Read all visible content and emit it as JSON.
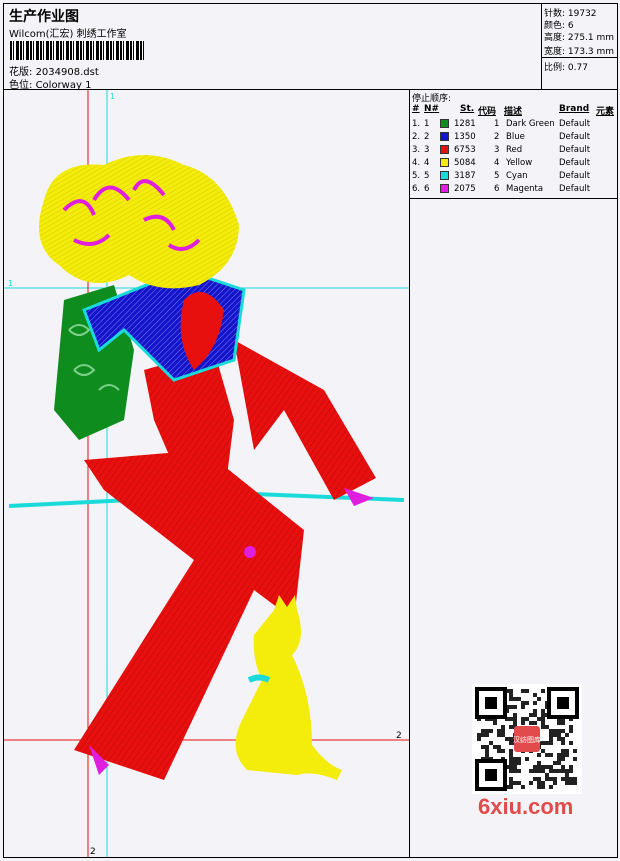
{
  "header": {
    "title": "生产作业图",
    "studio": "Wilcom(汇宏) 刺绣工作室",
    "file_label": "花版:",
    "file_name": "2034908.dst",
    "colorway_label": "色位:",
    "colorway": "Colorway 1"
  },
  "stats": {
    "stitches": "针数: 19732",
    "colors": "颜色: 6",
    "height": "高度: 275.1 mm",
    "width": "宽度: 173.3 mm",
    "scale": "比例: 0.77"
  },
  "stop_table": {
    "title": "停止顺序:",
    "headers": [
      "#",
      "N#",
      "St.",
      "代码",
      "描述",
      "Brand",
      "元素"
    ],
    "rows": [
      {
        "idx": "1.",
        "n": "1",
        "st": "1281",
        "code": "1",
        "desc": "Dark Green",
        "brand": "Default",
        "color": "#0f8c1e"
      },
      {
        "idx": "2.",
        "n": "2",
        "st": "1350",
        "code": "2",
        "desc": "Blue",
        "brand": "Default",
        "color": "#1414c8"
      },
      {
        "idx": "3.",
        "n": "3",
        "st": "6753",
        "code": "3",
        "desc": "Red",
        "brand": "Default",
        "color": "#e80f0f"
      },
      {
        "idx": "4.",
        "n": "4",
        "st": "5084",
        "code": "4",
        "desc": "Yellow",
        "brand": "Default",
        "color": "#f4ec0a"
      },
      {
        "idx": "5.",
        "n": "5",
        "st": "3187",
        "code": "5",
        "desc": "Cyan",
        "brand": "Default",
        "color": "#1adada"
      },
      {
        "idx": "6.",
        "n": "6",
        "st": "2075",
        "code": "6",
        "desc": "Magenta",
        "brand": "Default",
        "color": "#e01ee0"
      }
    ]
  },
  "guides": {
    "v_label": "1",
    "h_label": "1",
    "v2_label": "2",
    "h2_label": "2"
  },
  "watermark": "6xiu.com",
  "qr_caption": "汉纺图库"
}
